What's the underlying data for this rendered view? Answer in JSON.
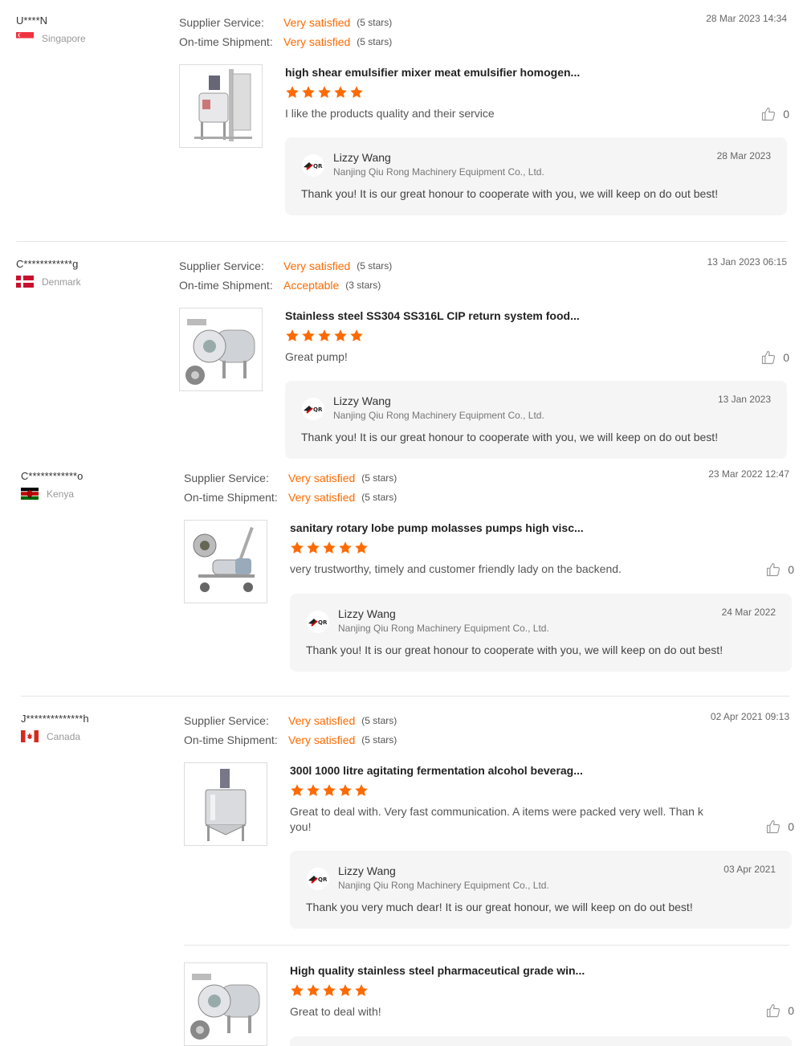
{
  "labels": {
    "supplier_service": "Supplier Service:",
    "ontime_shipment": "On-time Shipment:",
    "reply_name": "Lizzy Wang",
    "reply_company": "Nanjing Qiu Rong Machinery Equipment Co., Ltd.",
    "star_color": "#ff6a00",
    "accent_color": "#ff6a00"
  },
  "reviews": [
    {
      "buyer": "U****N",
      "country": "Singapore",
      "flag_icon": "singapore-flag-icon",
      "supplier_value": "Very satisfied",
      "supplier_stars": "(5 stars)",
      "shipment_value": "Very satisfied",
      "shipment_stars": "(5 stars)",
      "date": "28 Mar 2023 14:34",
      "product_title": "high shear emulsifier mixer meat emulsifier homogen...",
      "product_icon": "mixer-tank-product-image",
      "rating": 5,
      "comment": "I like the products quality and their service",
      "likes": "0",
      "reply_date": "28 Mar 2023",
      "reply_text": "Thank you! It is our great honour to cooperate with you, we will keep on do out best!"
    },
    {
      "buyer": "C************g",
      "country": "Denmark",
      "flag_icon": "denmark-flag-icon",
      "supplier_value": "Very satisfied",
      "supplier_stars": "(5 stars)",
      "shipment_value": "Acceptable",
      "shipment_stars": "(3 stars)",
      "date": "13 Jan 2023 06:15",
      "product_title": "Stainless steel SS304 SS316L CIP return system food...",
      "product_icon": "centrifugal-pump-product-image",
      "rating": 5,
      "comment": "Great pump!",
      "likes": "0",
      "reply_date": "13 Jan 2023",
      "reply_text": "Thank you! It is our great honour to cooperate with you, we will keep on do out best!"
    },
    {
      "buyer": "C************o",
      "country": "Kenya",
      "flag_icon": "kenya-flag-icon",
      "supplier_value": "Very satisfied",
      "supplier_stars": "(5 stars)",
      "shipment_value": "Very satisfied",
      "shipment_stars": "(5 stars)",
      "date": "23 Mar 2022 12:47",
      "product_title": "sanitary rotary lobe pump molasses pumps high visc...",
      "product_icon": "lobe-pump-product-image",
      "rating": 5,
      "comment": "very trustworthy, timely and customer friendly lady on the backend.",
      "likes": "0",
      "reply_date": "24 Mar 2022",
      "reply_text": "Thank you! It is our great honour to cooperate with you, we will keep on do out best!"
    },
    {
      "buyer": "J**************h",
      "country": "Canada",
      "flag_icon": "canada-flag-icon",
      "supplier_value": "Very satisfied",
      "supplier_stars": "(5 stars)",
      "shipment_value": "Very satisfied",
      "shipment_stars": "(5 stars)",
      "date": "02 Apr 2021 09:13",
      "product_title": "300l 1000 litre agitating fermentation alcohol beverag...",
      "product_icon": "fermentation-tank-product-image",
      "rating": 5,
      "comment": "Great to deal with. Very fast communication. A items were packed very well. Than k you!",
      "likes": "0",
      "reply_date": "03 Apr 2021",
      "reply_text": "Thank you very much dear! It is our great honour, we will keep on do out best!",
      "extra_product": {
        "product_title": "High quality stainless steel pharmaceutical grade win...",
        "product_icon": "centrifugal-pump-product-image",
        "rating": 5,
        "comment": "Great to deal with!",
        "likes": "0"
      }
    }
  ]
}
